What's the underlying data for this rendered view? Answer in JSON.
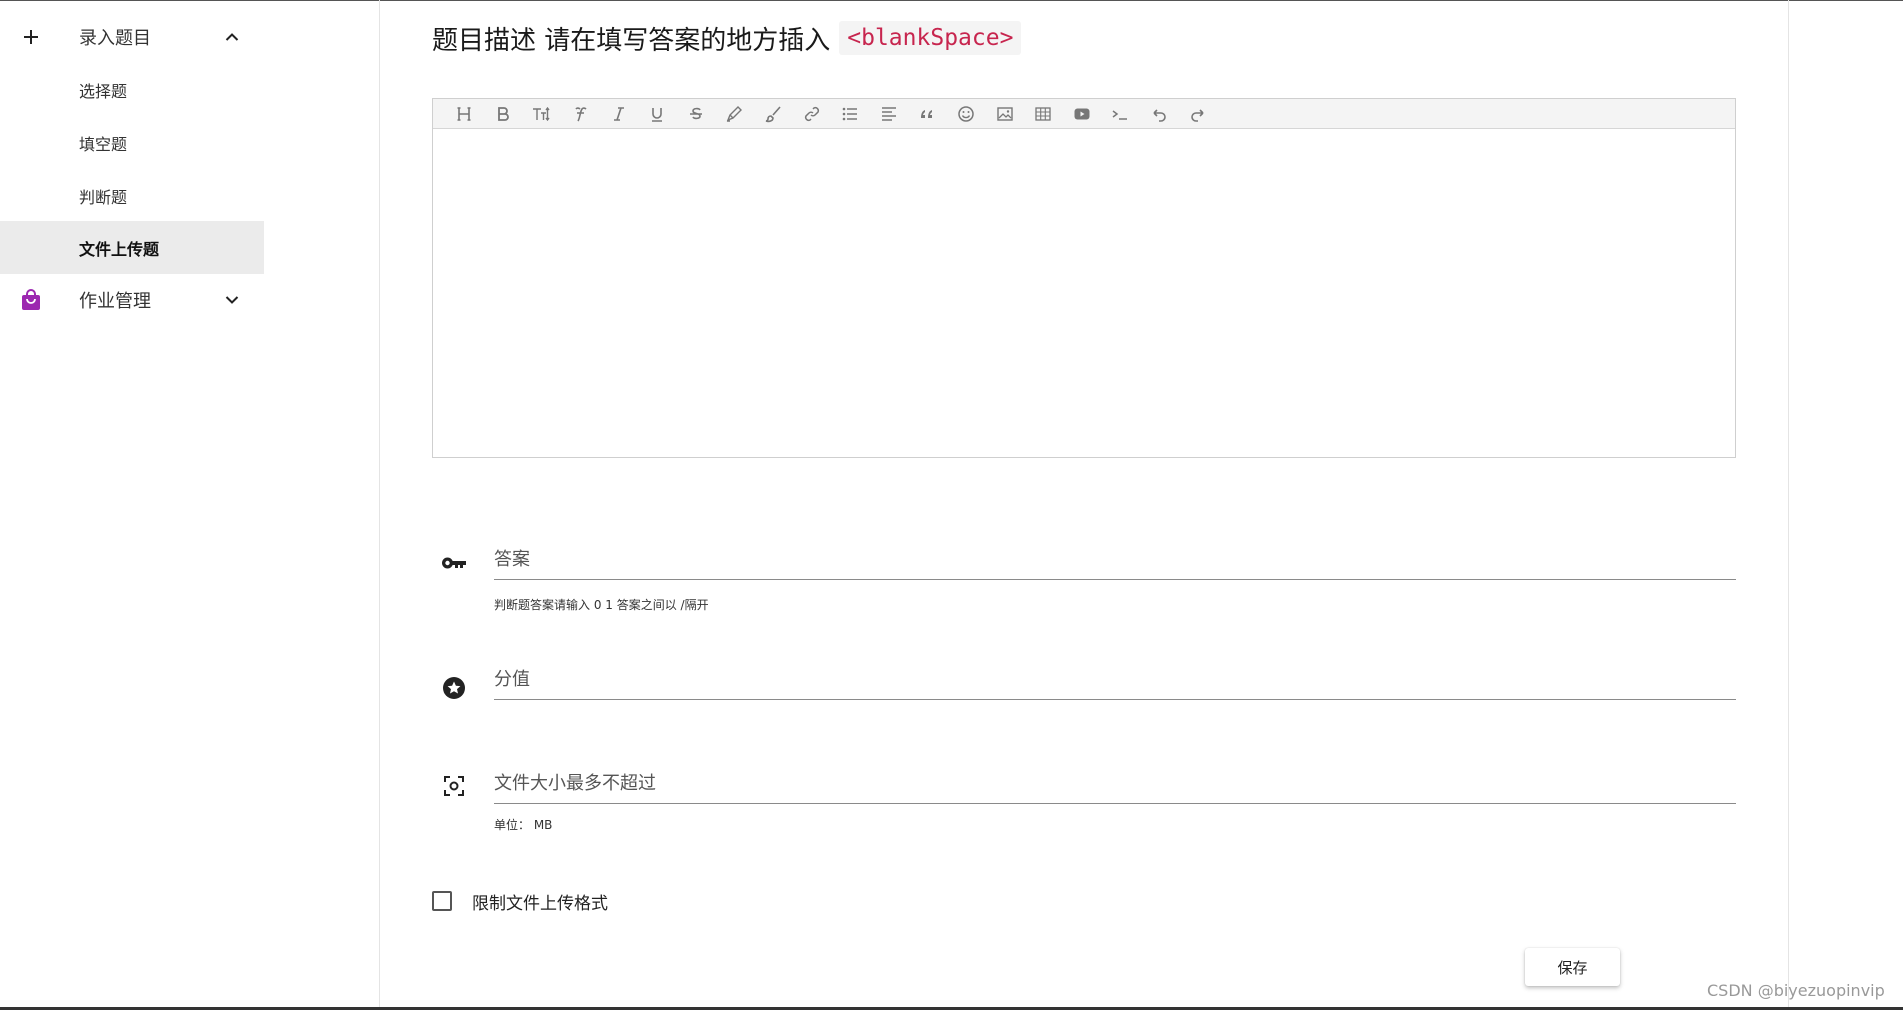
{
  "sidebar": {
    "groups": [
      {
        "label": "录入题目",
        "icon": "plus-icon",
        "expanded": true
      },
      {
        "label": "作业管理",
        "icon": "shopping-bag-icon",
        "expanded": false,
        "icon_color": "#9c27b0"
      }
    ],
    "items": [
      {
        "label": "选择题"
      },
      {
        "label": "填空题"
      },
      {
        "label": "判断题"
      },
      {
        "label": "文件上传题",
        "active": true
      }
    ]
  },
  "main": {
    "title": "题目描述 请在填写答案的地方插入",
    "title_code": "<blankSpace>",
    "toolbar_icons": [
      "heading-icon",
      "bold-icon",
      "text-size-icon",
      "font-icon",
      "italic-icon",
      "underline-icon",
      "strikethrough-icon",
      "pen-icon",
      "brush-icon",
      "link-icon",
      "list-icon",
      "align-icon",
      "quote-icon",
      "emoji-icon",
      "image-icon",
      "table-icon",
      "video-icon",
      "code-icon",
      "undo-icon",
      "redo-icon"
    ],
    "answer": {
      "placeholder": "答案",
      "hint": "判断题答案请输入 0 1 答案之间以 /隔开",
      "icon": "key-icon"
    },
    "score": {
      "placeholder": "分值",
      "icon": "star-circle-icon"
    },
    "file_size": {
      "placeholder": "文件大小最多不超过",
      "hint": "单位： MB",
      "icon": "center-focus-icon"
    },
    "limit_format": {
      "label": "限制文件上传格式",
      "checked": false
    },
    "save_label": "保存"
  },
  "watermark": "CSDN @biyezuopinvip",
  "colors": {
    "accent": "#9c27b0",
    "code": "#c7254e",
    "active_bg": "#ebebeb"
  }
}
